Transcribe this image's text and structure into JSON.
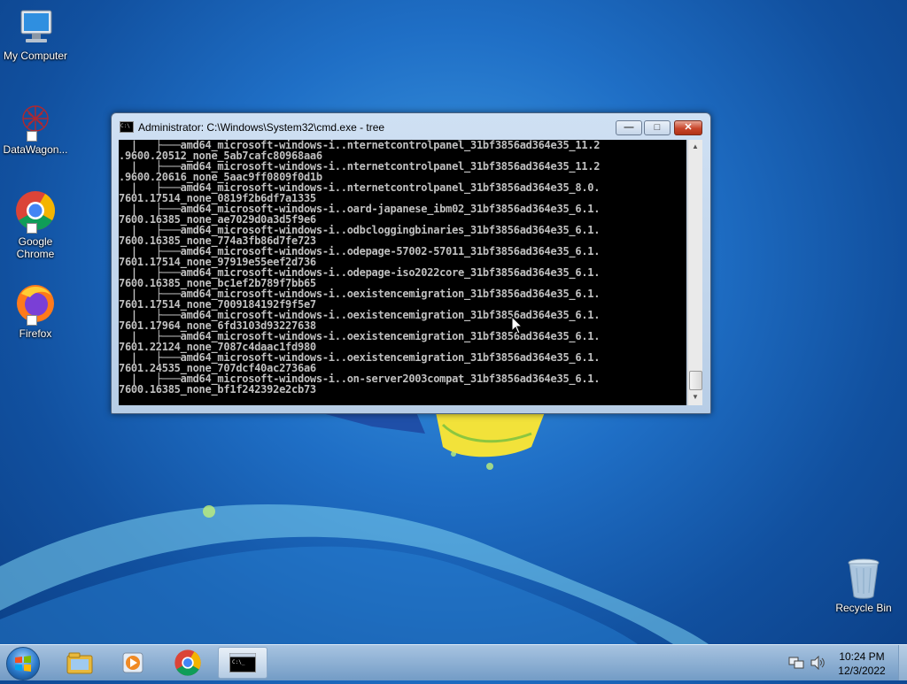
{
  "desktop": {
    "icons": [
      {
        "label": "My Computer",
        "icon": "computer-icon"
      },
      {
        "label": "DataWagon...",
        "icon": "datawagon-icon"
      },
      {
        "label": "Google Chrome",
        "icon": "chrome-icon"
      },
      {
        "label": "Firefox",
        "icon": "firefox-icon"
      },
      {
        "label": "Recycle Bin",
        "icon": "recycle-bin-icon"
      }
    ]
  },
  "window": {
    "title": "Administrator: C:\\Windows\\System32\\cmd.exe - tree",
    "icon_text": "C:\\",
    "minimize": "—",
    "maximize": "□",
    "close": "✕"
  },
  "console": {
    "lines": [
      "  |   ├───amd64_microsoft-windows-i..nternetcontrolpanel_31bf3856ad364e35_11.2",
      ".9600.20512_none_5ab7cafc80968aa6",
      "  |   ├───amd64_microsoft-windows-i..nternetcontrolpanel_31bf3856ad364e35_11.2",
      ".9600.20616_none_5aac9ff0809f0d1b",
      "  |   ├───amd64_microsoft-windows-i..nternetcontrolpanel_31bf3856ad364e35_8.0.",
      "7601.17514_none_0819f2b6df7a1335",
      "  |   ├───amd64_microsoft-windows-i..oard-japanese_ibm02_31bf3856ad364e35_6.1.",
      "7600.16385_none_ae7029d0a3d5f9e6",
      "  |   ├───amd64_microsoft-windows-i..odbcloggingbinaries_31bf3856ad364e35_6.1.",
      "7600.16385_none_774a3fb86d7fe723",
      "  |   ├───amd64_microsoft-windows-i..odepage-57002-57011_31bf3856ad364e35_6.1.",
      "7601.17514_none_97919e55eef2d736",
      "  |   ├───amd64_microsoft-windows-i..odepage-iso2022core_31bf3856ad364e35_6.1.",
      "7600.16385_none_bc1ef2b789f7bb65",
      "  |   ├───amd64_microsoft-windows-i..oexistencemigration_31bf3856ad364e35_6.1.",
      "7601.17514_none_7009184192f9f5e7",
      "  |   ├───amd64_microsoft-windows-i..oexistencemigration_31bf3856ad364e35_6.1.",
      "7601.17964_none_6fd3103d93227638",
      "  |   ├───amd64_microsoft-windows-i..oexistencemigration_31bf3856ad364e35_6.1.",
      "7601.22124_none_7087c4daac1fd980",
      "  |   ├───amd64_microsoft-windows-i..oexistencemigration_31bf3856ad364e35_6.1.",
      "7601.24535_none_707dcf40ac2736a6",
      "  |   ├───amd64_microsoft-windows-i..on-server2003compat_31bf3856ad364e35_6.1.",
      "7600.16385_none_bf1f242392e2cb73"
    ]
  },
  "taskbar": {
    "items": [
      "windows-explorer-icon",
      "media-player-icon",
      "chrome-icon",
      "cmd-icon"
    ],
    "clock_time": "10:24 PM",
    "clock_date": "12/3/2022"
  },
  "colors": {
    "console_text": "#c0c0c0",
    "console_bg": "#000000"
  }
}
